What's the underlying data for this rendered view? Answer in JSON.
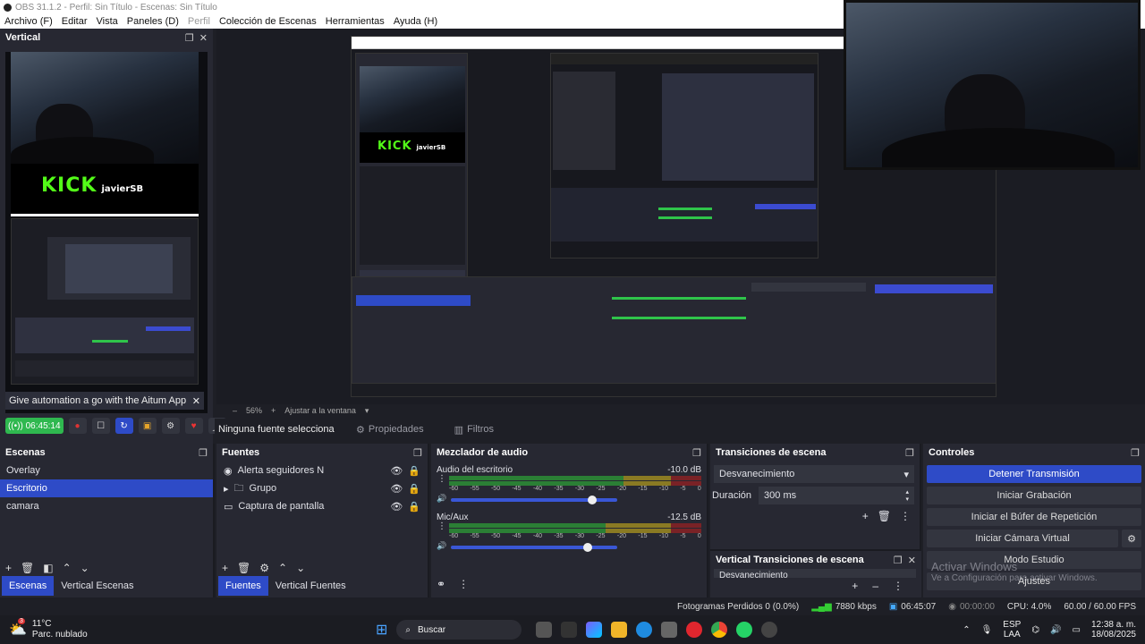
{
  "titlebar": {
    "title": "OBS 31.1.2 - Perfil: Sin Título - Escenas: Sin Título"
  },
  "menu": [
    {
      "label": "Archivo (F)",
      "disabled": false
    },
    {
      "label": "Editar",
      "disabled": false
    },
    {
      "label": "Vista",
      "disabled": false
    },
    {
      "label": "Paneles (D)",
      "disabled": false
    },
    {
      "label": "Perfil",
      "disabled": true
    },
    {
      "label": "Colección de Escenas",
      "disabled": false
    },
    {
      "label": "Herramientas",
      "disabled": false
    },
    {
      "label": "Ayuda (H)",
      "disabled": false
    }
  ],
  "vertical_dock": {
    "title": "Vertical",
    "preview_logo_text": "KICK",
    "preview_logo_sub": "javierSB",
    "notification": "Give automation a go with the Aitum App",
    "timer": "06:45:14"
  },
  "preview_zoom": {
    "zoom": "56%",
    "fit_label": "Ajustar a la ventana"
  },
  "source_bar": {
    "selected": "Ninguna fuente seleccionad",
    "properties": "Propiedades",
    "filters": "Filtros"
  },
  "scenes": {
    "title": "Escenas",
    "items": [
      "Overlay",
      "Escritorio",
      "camara"
    ],
    "selected_index": 1,
    "tabs": [
      "Escenas",
      "Vertical Escenas"
    ]
  },
  "sources": {
    "title": "Fuentes",
    "items": [
      {
        "label": "Alerta seguidores N",
        "icon": "browser-icon"
      },
      {
        "label": "Grupo",
        "icon": "folder-icon"
      },
      {
        "label": "Captura de pantalla",
        "icon": "monitor-icon"
      }
    ],
    "tabs": [
      "Fuentes",
      "Vertical Fuentes"
    ]
  },
  "mixer": {
    "title": "Mezclador de audio",
    "scale": [
      "-60",
      "-55",
      "-50",
      "-45",
      "-40",
      "-35",
      "-30",
      "-25",
      "-20",
      "-15",
      "-10",
      "-5",
      "0"
    ],
    "channels": [
      {
        "name": "Audio del escritorio",
        "db": "-10.0 dB",
        "level": 0.69,
        "fader": 0.85
      },
      {
        "name": "Mic/Aux",
        "db": "-12.5 dB",
        "level": 0.62,
        "fader": 0.82
      }
    ]
  },
  "transitions": {
    "title": "Transiciones de escena",
    "type": "Desvanecimiento",
    "duration_label": "Duración",
    "duration_value": "300 ms",
    "vertical_title": "Vertical Transiciones de escena",
    "vertical_type": "Desvanecimiento"
  },
  "controls": {
    "title": "Controles",
    "buttons": [
      "Detener Transmisión",
      "Iniciar Grabación",
      "Iniciar el Búfer de Repetición",
      "Iniciar Cámara Virtual",
      "Modo Estudio",
      "Ajustes"
    ]
  },
  "watermark": {
    "line1": "Activar Windows",
    "line2": "Ve a Configuración para activar Windows."
  },
  "status": {
    "frames": "Fotogramas Perdidos 0 (0.0%)",
    "bitrate": "7880 kbps",
    "stream_time": "06:45:07",
    "rec_time": "00:00:00",
    "cpu": "CPU: 4.0%",
    "fps": "60.00 / 60.00 FPS"
  },
  "taskbar": {
    "weather_temp": "11°C",
    "weather_desc": "Parc. nublado",
    "weather_badge": "3",
    "search": "Buscar",
    "lang1": "ESP",
    "lang2": "LAA",
    "time": "12:38 a. m.",
    "date": "18/08/2025"
  }
}
